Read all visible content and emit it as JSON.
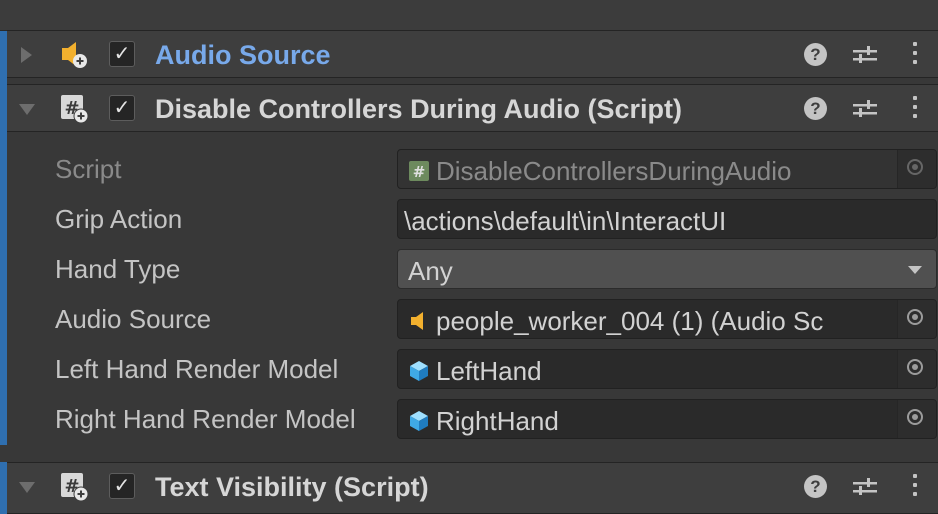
{
  "colors": {
    "background": "#383838",
    "header": "#3e3e3e",
    "accent": "#2f6fb0",
    "link_title": "#78a9ea",
    "field": "#2a2a2a"
  },
  "components": [
    {
      "title": "Audio Source",
      "enabled": "✓",
      "expanded": false,
      "icon": "audio-source-icon"
    },
    {
      "title": "Disable Controllers During Audio (Script)",
      "enabled": "✓",
      "expanded": true,
      "icon": "script-icon"
    },
    {
      "title": "Text Visibility (Script)",
      "enabled": "✓",
      "expanded": true,
      "icon": "script-icon"
    }
  ],
  "header_buttons": {
    "help": "?",
    "presets": "presets-icon",
    "menu": "kebab-menu-icon"
  },
  "fields": [
    {
      "label": "Script",
      "value": "DisableControllersDuringAudio",
      "icon": "script-file-icon",
      "readonly": true
    },
    {
      "label": "Grip Action",
      "value": "\\actions\\default\\in\\InteractUI"
    },
    {
      "label": "Hand Type",
      "value": "Any",
      "type": "dropdown"
    },
    {
      "label": "Audio Source",
      "value": "people_worker_004 (1) (Audio Sc",
      "icon": "audio-source-icon"
    },
    {
      "label": "Left Hand Render Model",
      "value": "LeftHand",
      "icon": "prefab-cube-icon"
    },
    {
      "label": "Right Hand Render Model",
      "value": "RightHand",
      "icon": "prefab-cube-icon"
    }
  ]
}
